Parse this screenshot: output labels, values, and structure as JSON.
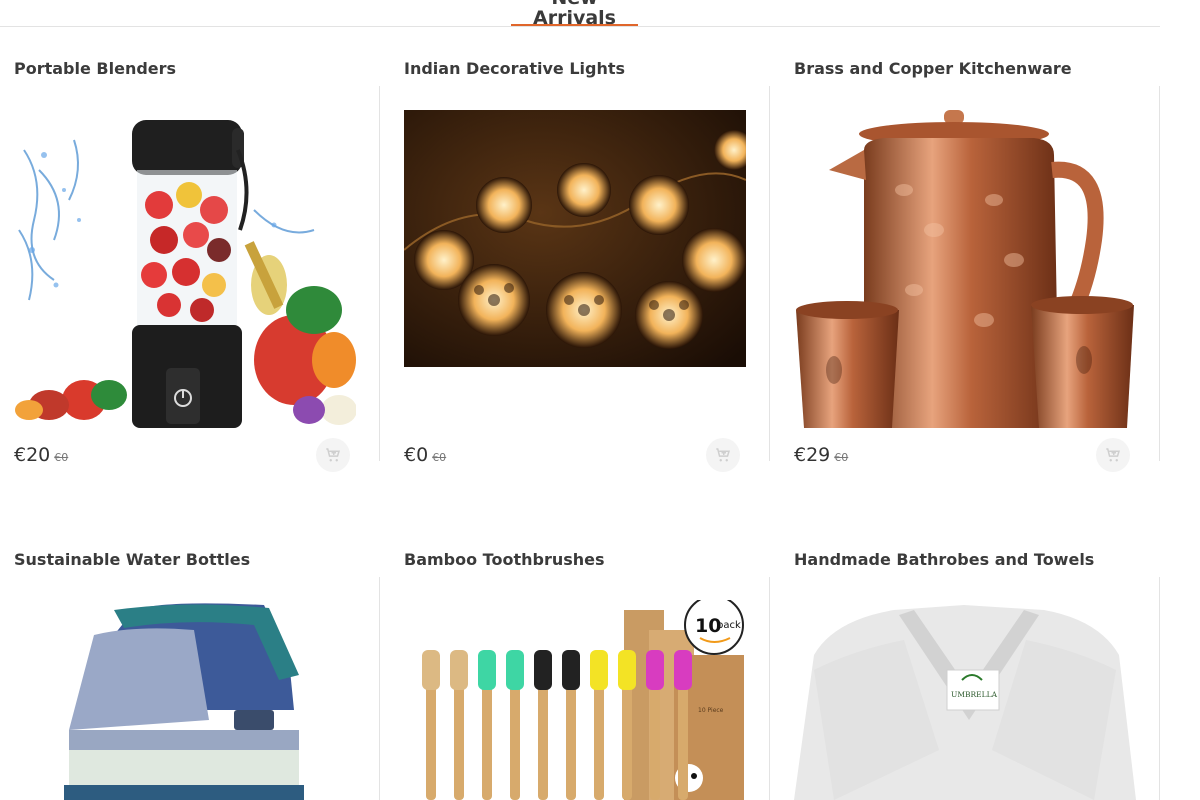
{
  "header": {
    "active_tab": "New Arrivals"
  },
  "currency_symbol": "€",
  "products": [
    {
      "name": "Portable Blenders",
      "price": "€20",
      "old_price": "€0",
      "cart_icon": "add-to-cart-icon"
    },
    {
      "name": "Indian Decorative Lights",
      "price": "€0",
      "old_price": "€0",
      "cart_icon": "add-to-cart-icon"
    },
    {
      "name": "Brass and Copper Kitchenware",
      "price": "€29",
      "old_price": "€0",
      "cart_icon": "add-to-cart-icon"
    },
    {
      "name": "Sustainable Water Bottles"
    },
    {
      "name": "Bamboo Toothbrushes",
      "badge": "10",
      "badge_sub": "pack",
      "box_label": "10 Piece"
    },
    {
      "name": "Handmade Bathrobes and Towels",
      "robe_label": "UMBRELLA"
    }
  ],
  "colors": {
    "accent": "#e0662b",
    "divider": "#e3e3e3",
    "text": "#3b3b3b"
  }
}
